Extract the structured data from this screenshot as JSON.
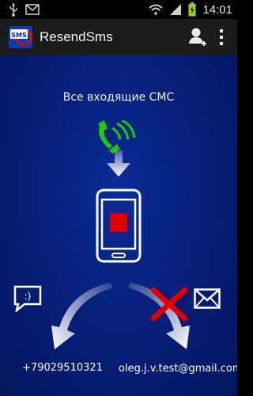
{
  "status_bar": {
    "time": "14:01",
    "icons": [
      "usb-icon",
      "notification-mail-icon",
      "wifi-icon",
      "signal-icon",
      "battery-charging-icon"
    ]
  },
  "action_bar": {
    "app_title": "ResendSms",
    "logo_text": "SMS",
    "actions": [
      "add-contact-icon",
      "overflow-menu-icon"
    ]
  },
  "main": {
    "incoming_label": "Все входящие СМС",
    "phone_number": "+79029510321",
    "email_address": "oleg.j.v.test@gmail.com"
  },
  "colors": {
    "background": "#07207a",
    "accent_green": "#22c800",
    "cross_red": "#e00000",
    "phone_screen_red": "#e00000"
  }
}
